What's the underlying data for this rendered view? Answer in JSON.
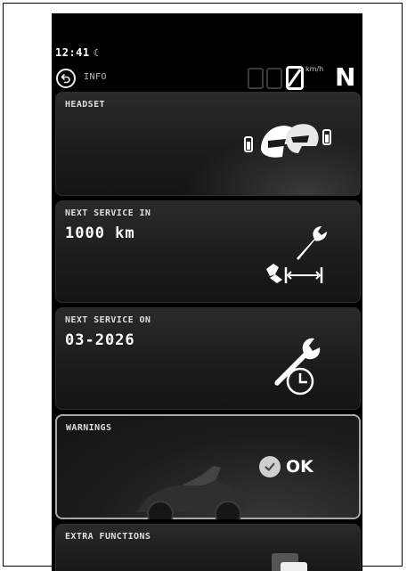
{
  "status": {
    "time": "12:41",
    "moon_icon": "☾"
  },
  "header": {
    "back_icon": "back-arrow-icon",
    "title": "INFO"
  },
  "speed": {
    "value": "0",
    "unit": "km/h",
    "gear": "N"
  },
  "cards": {
    "headset": {
      "title": "HEADSET",
      "icon": "headset-helmets-icon"
    },
    "service_km": {
      "title": "NEXT SERVICE IN",
      "value": "1000 km",
      "icon": "wrench-distance-icon"
    },
    "service_date": {
      "title": "NEXT SERVICE ON",
      "value": "03-2026",
      "icon": "wrench-clock-icon"
    },
    "warnings": {
      "title": "WARNINGS",
      "status": "OK",
      "icon": "check-circle-icon"
    },
    "extra": {
      "title": "EXTRA FUNCTIONS",
      "icon": "extra-functions-icon"
    }
  },
  "colors": {
    "background": "#000000",
    "card": "#1e1e1e",
    "selected_border": "#a8a8a8",
    "text": "#ffffff"
  }
}
